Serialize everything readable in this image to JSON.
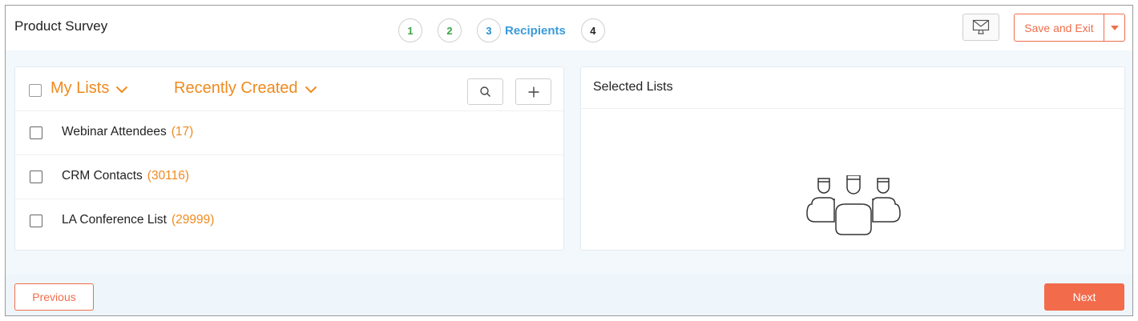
{
  "header": {
    "title": "Product Survey",
    "steps": [
      {
        "number": "1",
        "state": "done"
      },
      {
        "number": "2",
        "state": "done"
      },
      {
        "number": "3",
        "state": "active",
        "label": "Recipients"
      },
      {
        "number": "4",
        "state": "todo"
      }
    ],
    "preview_icon": "monitor-mail-icon",
    "save_label": "Save and Exit"
  },
  "lists_panel": {
    "source_dropdown": "My Lists",
    "sort_dropdown": "Recently Created",
    "search_icon": "search-icon",
    "add_icon": "plus-icon",
    "items": [
      {
        "name": "Webinar Attendees",
        "count": "(17)"
      },
      {
        "name": "CRM Contacts",
        "count": "(30116)"
      },
      {
        "name": "LA Conference List",
        "count": "(29999)"
      }
    ]
  },
  "selected_panel": {
    "title": "Selected Lists",
    "empty_icon": "people-group-icon"
  },
  "footer": {
    "previous_label": "Previous",
    "next_label": "Next"
  },
  "colors": {
    "accent": "#ef6e4c",
    "list_orange": "#ef8a1f",
    "step_done": "#3aa648",
    "step_active": "#2a8fd0",
    "page_bg": "#f2f8fc"
  }
}
